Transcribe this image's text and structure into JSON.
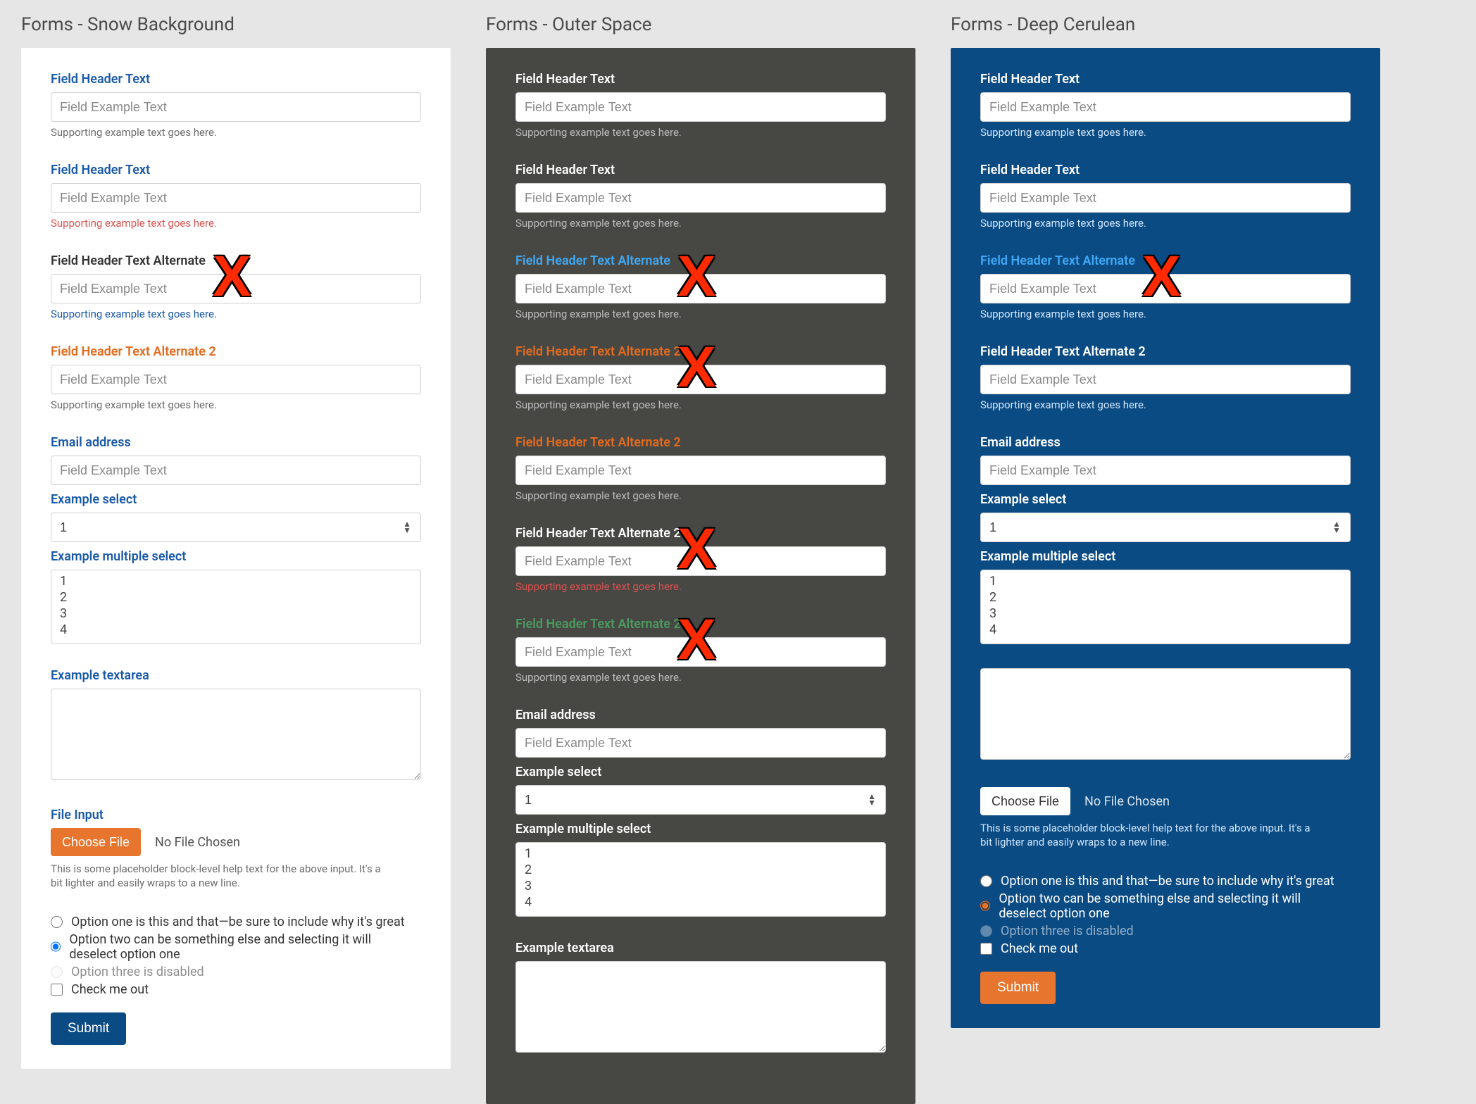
{
  "shared": {
    "placeholder": "Field Example Text",
    "support": "Supporting example text goes here.",
    "no_file": "No File Chosen",
    "choose_file": "Choose File",
    "submit": "Submit",
    "email_label": "Email address",
    "select_label": "Example select",
    "multi_label": "Example multiple select",
    "textarea_label": "Example textarea",
    "file_label": "File Input",
    "file_help": "This is some placeholder block-level help text for the above input. It's a bit lighter and easily wraps to a new line.",
    "select_value": "1",
    "multi_options": [
      "1",
      "2",
      "3",
      "4"
    ],
    "radios": [
      {
        "label": "Option one is this and that—be sure to include why it's great",
        "checked": false,
        "disabled": false
      },
      {
        "label": "Option two can be something else and selecting it will deselect option one",
        "checked": true,
        "disabled": false
      },
      {
        "label": "Option three is disabled",
        "checked": false,
        "disabled": true
      }
    ],
    "check_label": "Check me out"
  },
  "columns": [
    {
      "title": "Forms - Snow Background",
      "theme": "snow",
      "fields": [
        {
          "header": "Field Header Text",
          "hclass": "lbl-blue",
          "sclass": "sup-gray",
          "x": false
        },
        {
          "header": "Field Header Text",
          "hclass": "lbl-blue",
          "sclass": "sup-red",
          "x": false
        },
        {
          "header": "Field Header Text Alternate",
          "hclass": "lbl-dark",
          "sclass": "sup-blue",
          "x": true
        },
        {
          "header": "Field Header Text Alternate 2",
          "hclass": "lbl-orange",
          "sclass": "sup-gray",
          "x": false
        }
      ],
      "extras_label_class": "lbl-blue",
      "file_btn_class": "orange",
      "submit_class": "navy",
      "show_textarea_label": true,
      "show_file_label": true,
      "show_extras": true
    },
    {
      "title": "Forms - Outer Space",
      "theme": "space",
      "fields": [
        {
          "header": "Field Header Text",
          "hclass": "lbl-white",
          "sclass": "sup-ltgray",
          "x": false
        },
        {
          "header": "Field Header Text",
          "hclass": "lbl-white",
          "sclass": "sup-ltgray",
          "x": false
        },
        {
          "header": "Field Header Text Alternate",
          "hclass": "lbl-cyan",
          "sclass": "sup-ltgray",
          "x": true
        },
        {
          "header": "Field Header Text Alternate 2",
          "hclass": "lbl-orange",
          "sclass": "sup-ltgray",
          "x": true
        },
        {
          "header": "Field Header Text Alternate 2",
          "hclass": "lbl-orange",
          "sclass": "sup-ltgray",
          "x": false
        },
        {
          "header": "Field Header Text Alternate 2",
          "hclass": "lbl-white",
          "sclass": "sup-red",
          "x": true
        },
        {
          "header": "Field Header Text Alternate 2",
          "hclass": "lbl-green",
          "sclass": "sup-ltgray",
          "x": true
        }
      ],
      "extras_label_class": "lbl-white",
      "file_btn_class": "orange",
      "submit_class": "navy",
      "show_textarea_label": true,
      "show_file_label": true,
      "show_extras": false
    },
    {
      "title": "Forms - Deep Cerulean",
      "theme": "cerul",
      "fields": [
        {
          "header": "Field Header Text",
          "hclass": "lbl-white",
          "sclass": "sup-ltblue",
          "x": false
        },
        {
          "header": "Field Header Text",
          "hclass": "lbl-white",
          "sclass": "sup-ltblue",
          "x": false
        },
        {
          "header": "Field Header Text Alternate",
          "hclass": "lbl-cyan",
          "sclass": "sup-ltblue",
          "x": true
        },
        {
          "header": "Field Header Text Alternate 2",
          "hclass": "lbl-white",
          "sclass": "sup-ltblue",
          "x": false
        }
      ],
      "extras_label_class": "lbl-white",
      "file_btn_class": "white",
      "submit_class": "orange",
      "show_textarea_label": false,
      "show_file_label": false,
      "show_extras": true
    }
  ]
}
